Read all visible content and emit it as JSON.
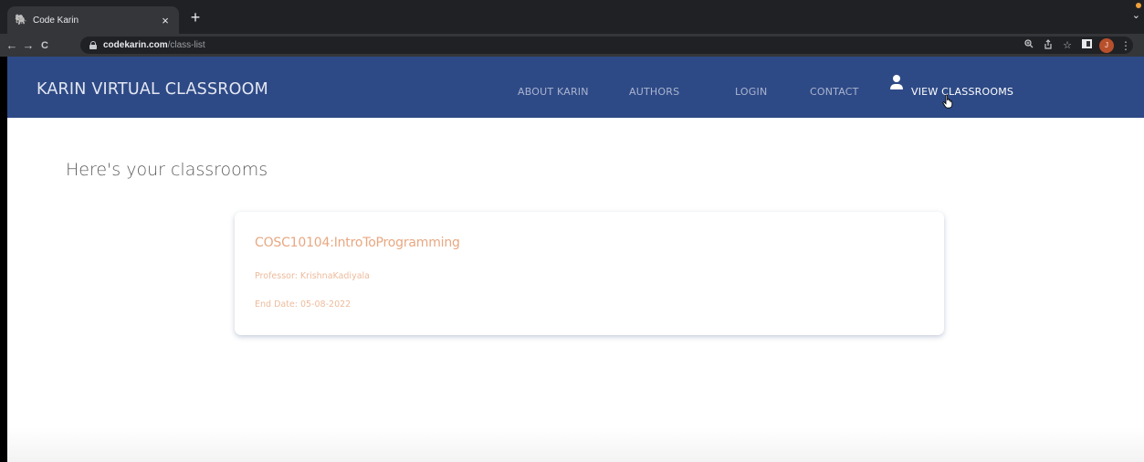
{
  "browser": {
    "tab_title": "Code Karin",
    "tab_favicon": "elephant-icon",
    "tab_close": "×",
    "new_tab": "+",
    "tab_menu": "⌄",
    "nav": {
      "back": "←",
      "forward": "→",
      "reload": "C"
    },
    "url_host": "codekarin.com",
    "url_path": "/class-list",
    "icons": [
      "zoom-icon",
      "share-icon",
      "bookmark-star-icon",
      "sidepanel-icon"
    ],
    "profile_initial": "J",
    "menu": "⋮"
  },
  "navbar": {
    "brand": "KARIN VIRTUAL CLASSROOM",
    "links": [
      {
        "label": "ABOUT KARIN"
      },
      {
        "label": "AUTHORS"
      },
      {
        "label": "LOGIN"
      },
      {
        "label": "CONTACT"
      },
      {
        "label": "VIEW CLASSROOMS",
        "active": true
      }
    ],
    "user_icon": "user-icon"
  },
  "main": {
    "heading": "Here's your classrooms",
    "classrooms": [
      {
        "course": "COSC10104:IntroToProgramming",
        "professor": "Professor: KrishnaKadiyala",
        "end_date": "End Date: 05-08-2022"
      }
    ]
  },
  "colors": {
    "navbar_bg": "#2e4a86",
    "accent_text": "#e8a882",
    "chrome_dark": "#202124"
  }
}
